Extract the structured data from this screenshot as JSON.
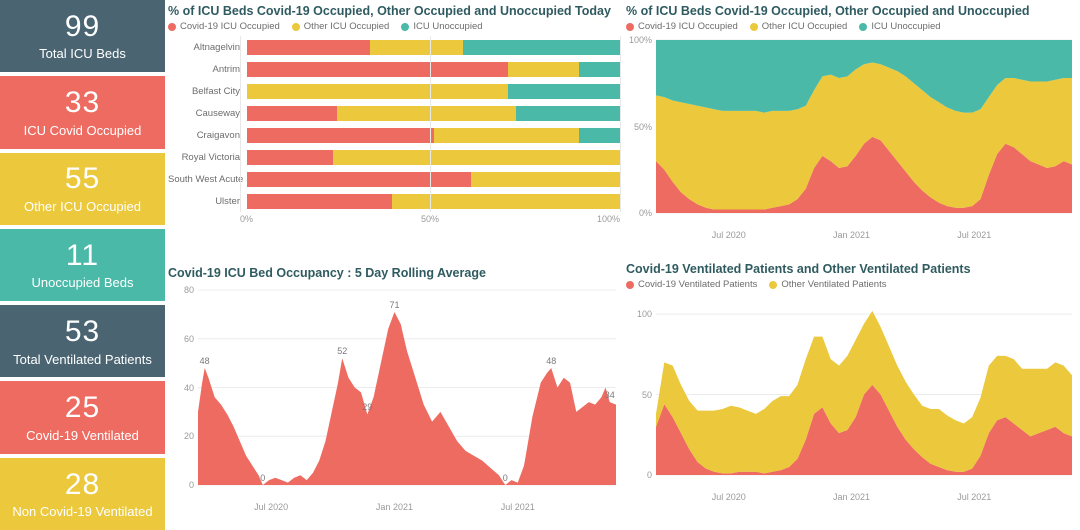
{
  "colors": {
    "covid": "#ED6B61",
    "other": "#EBC83C",
    "unoccupied": "#4BB9A7",
    "slate": "#4A6472",
    "title": "#2F5B60",
    "axis": "#9A9A9A",
    "grid": "#ECECEC"
  },
  "kpis": [
    {
      "value": "99",
      "label": "Total ICU Beds",
      "color": "#4A6472"
    },
    {
      "value": "33",
      "label": "ICU Covid Occupied",
      "color": "#ED6B61"
    },
    {
      "value": "55",
      "label": "Other ICU Occupied",
      "color": "#EBC83C"
    },
    {
      "value": "11",
      "label": "Unoccupied Beds",
      "color": "#4BB9A7"
    },
    {
      "value": "53",
      "label": "Total Ventilated Patients",
      "color": "#4A6472"
    },
    {
      "value": "25",
      "label": "Covid-19 Ventilated",
      "color": "#ED6B61"
    },
    {
      "value": "28",
      "label": "Non Covid-19 Ventilated",
      "color": "#EBC83C"
    }
  ],
  "panels": {
    "hospital_bars": {
      "title": "% of ICU Beds Covid-19 Occupied, Other Occupied and Unoccupied Today",
      "legend": [
        {
          "label": "Covid-19 ICU Occupied",
          "color": "#ED6B61"
        },
        {
          "label": "Other ICU Occupied",
          "color": "#EBC83C"
        },
        {
          "label": "ICU Unoccupied",
          "color": "#4BB9A7"
        }
      ]
    },
    "icu_trend": {
      "title": "% of ICU Beds Covid-19 Occupied, Other Occupied and Unoccupied",
      "legend": [
        {
          "label": "Covid-19 ICU Occupied",
          "color": "#ED6B61"
        },
        {
          "label": "Other ICU Occupied",
          "color": "#EBC83C"
        },
        {
          "label": "ICU Unoccupied",
          "color": "#4BB9A7"
        }
      ]
    },
    "occupancy": {
      "title": "Covid-19 ICU Bed Occupancy : 5 Day Rolling Average"
    },
    "ventilated": {
      "title": "Covid-19 Ventilated Patients and Other Ventilated Patients",
      "legend": [
        {
          "label": "Covid-19 Ventilated Patients",
          "color": "#ED6B61"
        },
        {
          "label": "Other Ventilated Patients",
          "color": "#EBC83C"
        }
      ]
    }
  },
  "chart_data": [
    {
      "id": "hospital_bars",
      "type": "bar",
      "orientation": "horizontal",
      "stacked": true,
      "title": "% of ICU Beds Covid-19 Occupied, Other Occupied and Unoccupied Today",
      "xlabel": "",
      "ylabel": "",
      "xlim": [
        0,
        100
      ],
      "xticks": [
        "0%",
        "50%",
        "100%"
      ],
      "xtick_values": [
        0,
        50,
        100
      ],
      "grid": true,
      "legend_position": "top",
      "categories": [
        "Altnagelvin",
        "Antrim",
        "Belfast City",
        "Causeway",
        "Craigavon",
        "Royal Victoria",
        "South West Acute",
        "Ulster"
      ],
      "series": [
        {
          "name": "Covid-19 ICU Occupied",
          "color": "#ED6B61",
          "values": [
            33,
            70,
            0,
            24,
            50,
            23,
            60,
            39
          ]
        },
        {
          "name": "Other ICU Occupied",
          "color": "#EBC83C",
          "values": [
            25,
            19,
            70,
            48,
            39,
            77,
            40,
            61
          ]
        },
        {
          "name": "ICU Unoccupied",
          "color": "#4BB9A7",
          "values": [
            42,
            11,
            30,
            28,
            11,
            0,
            0,
            0
          ]
        }
      ]
    },
    {
      "id": "icu_trend",
      "type": "area",
      "stacked": true,
      "title": "% of ICU Beds Covid-19 Occupied, Other Occupied and Unoccupied",
      "xlabel": "",
      "ylabel": "",
      "ylim": [
        0,
        100
      ],
      "yticks": [
        "0%",
        "50%",
        "100%"
      ],
      "ytick_values": [
        0,
        50,
        100
      ],
      "xticks": [
        "Jul 2020",
        "Jan 2021",
        "Jul 2021"
      ],
      "xtick_positions": [
        0.175,
        0.47,
        0.765
      ],
      "grid": false,
      "legend_position": "top",
      "x": [
        0,
        0.02,
        0.04,
        0.06,
        0.08,
        0.1,
        0.12,
        0.14,
        0.16,
        0.18,
        0.2,
        0.22,
        0.24,
        0.26,
        0.28,
        0.3,
        0.32,
        0.34,
        0.36,
        0.38,
        0.4,
        0.42,
        0.44,
        0.46,
        0.48,
        0.5,
        0.52,
        0.54,
        0.56,
        0.58,
        0.6,
        0.62,
        0.64,
        0.66,
        0.68,
        0.7,
        0.72,
        0.74,
        0.76,
        0.78,
        0.8,
        0.82,
        0.84,
        0.86,
        0.88,
        0.9,
        0.92,
        0.94,
        0.96,
        0.98,
        1
      ],
      "series": [
        {
          "name": "Covid-19 ICU Occupied",
          "color": "#ED6B61",
          "values": [
            30,
            25,
            18,
            12,
            8,
            5,
            3,
            2,
            2,
            2,
            2,
            2,
            2,
            2,
            3,
            4,
            5,
            8,
            14,
            26,
            33,
            30,
            26,
            27,
            33,
            40,
            44,
            42,
            36,
            30,
            24,
            18,
            13,
            9,
            6,
            4,
            3,
            3,
            4,
            8,
            22,
            34,
            40,
            38,
            34,
            30,
            28,
            26,
            27,
            30,
            28
          ]
        },
        {
          "name": "Other ICU Occupied",
          "color": "#EBC83C",
          "values": [
            38,
            42,
            47,
            52,
            55,
            57,
            58,
            58,
            57,
            57,
            57,
            57,
            57,
            56,
            56,
            55,
            54,
            52,
            48,
            45,
            46,
            50,
            52,
            52,
            50,
            46,
            43,
            44,
            48,
            52,
            55,
            57,
            58,
            58,
            58,
            57,
            56,
            55,
            54,
            52,
            45,
            40,
            38,
            40,
            43,
            46,
            48,
            50,
            50,
            48,
            50
          ]
        },
        {
          "name": "ICU Unoccupied",
          "color": "#4BB9A7",
          "values": [
            32,
            33,
            35,
            36,
            37,
            38,
            39,
            40,
            41,
            41,
            41,
            41,
            41,
            42,
            41,
            41,
            41,
            40,
            38,
            29,
            21,
            20,
            22,
            21,
            17,
            14,
            13,
            14,
            16,
            18,
            21,
            25,
            29,
            33,
            36,
            39,
            41,
            42,
            42,
            40,
            33,
            26,
            22,
            22,
            23,
            24,
            24,
            24,
            23,
            22,
            22
          ]
        }
      ]
    },
    {
      "id": "occupancy",
      "type": "area",
      "stacked": false,
      "title": "Covid-19 ICU Bed Occupancy : 5 Day Rolling Average",
      "xlabel": "",
      "ylabel": "",
      "ylim": [
        0,
        80
      ],
      "yticks": [
        "0",
        "20",
        "40",
        "60",
        "80"
      ],
      "ytick_values": [
        0,
        20,
        40,
        60,
        80
      ],
      "xticks": [
        "Jul 2020",
        "Jan 2021",
        "Jul 2021"
      ],
      "xtick_positions": [
        0.175,
        0.47,
        0.765
      ],
      "grid": true,
      "color": "#ED6B61",
      "annotations": [
        {
          "label": "48",
          "x": 0.016,
          "y": 48
        },
        {
          "label": "0",
          "x": 0.155,
          "y": 0
        },
        {
          "label": "52",
          "x": 0.345,
          "y": 52
        },
        {
          "label": "29",
          "x": 0.405,
          "y": 29
        },
        {
          "label": "71",
          "x": 0.47,
          "y": 71
        },
        {
          "label": "0",
          "x": 0.735,
          "y": 0
        },
        {
          "label": "48",
          "x": 0.845,
          "y": 48
        },
        {
          "label": "34",
          "x": 0.985,
          "y": 34
        }
      ],
      "x": [
        0,
        0.01,
        0.016,
        0.025,
        0.04,
        0.055,
        0.07,
        0.085,
        0.1,
        0.115,
        0.13,
        0.145,
        0.155,
        0.17,
        0.185,
        0.2,
        0.215,
        0.23,
        0.245,
        0.26,
        0.275,
        0.29,
        0.305,
        0.32,
        0.335,
        0.345,
        0.36,
        0.375,
        0.39,
        0.405,
        0.42,
        0.44,
        0.455,
        0.47,
        0.485,
        0.5,
        0.52,
        0.54,
        0.56,
        0.58,
        0.6,
        0.62,
        0.64,
        0.66,
        0.68,
        0.7,
        0.72,
        0.735,
        0.75,
        0.765,
        0.78,
        0.8,
        0.82,
        0.835,
        0.845,
        0.86,
        0.875,
        0.89,
        0.905,
        0.92,
        0.935,
        0.95,
        0.965,
        0.975,
        0.985,
        1
      ],
      "values": [
        30,
        42,
        48,
        44,
        36,
        33,
        29,
        24,
        18,
        12,
        8,
        4,
        0,
        2,
        3,
        2,
        1,
        3,
        4,
        2,
        5,
        10,
        18,
        30,
        42,
        52,
        44,
        40,
        38,
        29,
        36,
        52,
        64,
        71,
        66,
        55,
        44,
        33,
        26,
        30,
        24,
        18,
        14,
        12,
        10,
        7,
        4,
        0,
        2,
        1,
        8,
        28,
        42,
        46,
        48,
        40,
        44,
        42,
        30,
        32,
        34,
        33,
        36,
        40,
        34,
        33
      ]
    },
    {
      "id": "ventilated",
      "type": "area",
      "stacked": true,
      "title": "Covid-19 Ventilated Patients and Other Ventilated Patients",
      "xlabel": "",
      "ylabel": "",
      "ylim": [
        0,
        110
      ],
      "yticks": [
        "0",
        "50",
        "100"
      ],
      "ytick_values": [
        0,
        50,
        100
      ],
      "xticks": [
        "Jul 2020",
        "Jan 2021",
        "Jul 2021"
      ],
      "xtick_positions": [
        0.175,
        0.47,
        0.765
      ],
      "grid": true,
      "legend_position": "top",
      "x": [
        0,
        0.02,
        0.04,
        0.06,
        0.08,
        0.1,
        0.12,
        0.14,
        0.16,
        0.18,
        0.2,
        0.22,
        0.24,
        0.26,
        0.28,
        0.3,
        0.32,
        0.34,
        0.36,
        0.38,
        0.4,
        0.42,
        0.44,
        0.46,
        0.48,
        0.5,
        0.52,
        0.54,
        0.56,
        0.58,
        0.6,
        0.62,
        0.64,
        0.66,
        0.68,
        0.7,
        0.72,
        0.74,
        0.76,
        0.78,
        0.8,
        0.82,
        0.84,
        0.86,
        0.88,
        0.9,
        0.92,
        0.94,
        0.96,
        0.98,
        1
      ],
      "series": [
        {
          "name": "Covid-19 Ventilated Patients",
          "color": "#ED6B61",
          "values": [
            30,
            44,
            36,
            26,
            16,
            8,
            4,
            2,
            1,
            1,
            2,
            2,
            2,
            1,
            2,
            3,
            5,
            10,
            22,
            38,
            42,
            32,
            26,
            28,
            36,
            50,
            56,
            50,
            40,
            30,
            22,
            16,
            11,
            7,
            5,
            3,
            2,
            2,
            4,
            12,
            26,
            34,
            36,
            32,
            28,
            24,
            26,
            28,
            30,
            26,
            24
          ]
        },
        {
          "name": "Other Ventilated Patients",
          "color": "#EBC83C",
          "values": [
            8,
            26,
            32,
            30,
            30,
            32,
            36,
            38,
            40,
            42,
            40,
            38,
            36,
            40,
            44,
            46,
            44,
            46,
            50,
            48,
            44,
            40,
            42,
            46,
            48,
            44,
            46,
            42,
            40,
            38,
            36,
            34,
            32,
            34,
            36,
            34,
            32,
            30,
            32,
            36,
            42,
            40,
            38,
            40,
            38,
            42,
            40,
            38,
            40,
            42,
            38
          ]
        }
      ]
    }
  ]
}
